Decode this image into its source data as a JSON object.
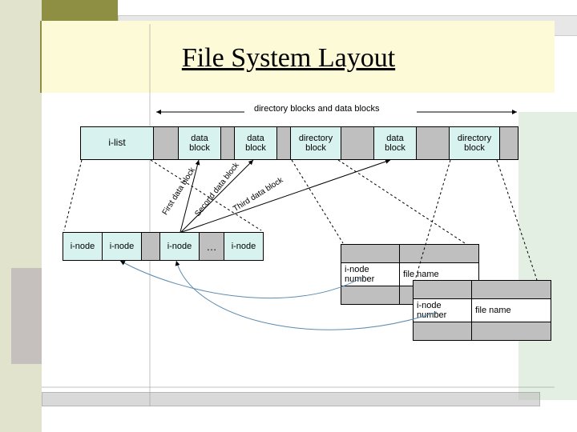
{
  "title": "File System Layout",
  "top_caption": "directory blocks and data blocks",
  "top_row": {
    "ilist": "i-list",
    "b1": "data\nblock",
    "b2": "data\nblock",
    "b3": "directory\nblock",
    "b4": "data\nblock",
    "b5": "directory\nblock"
  },
  "arrows_labels": {
    "a1": "First data block",
    "a2": "Second data block",
    "a3": "Third data block"
  },
  "bottom_row": {
    "n1": "i-node",
    "n2": "i-node",
    "n3": "i-node",
    "dots": "…",
    "n4": "i-node"
  },
  "dir_entry": {
    "col1": "i-node\nnumber",
    "col2": "file name"
  }
}
